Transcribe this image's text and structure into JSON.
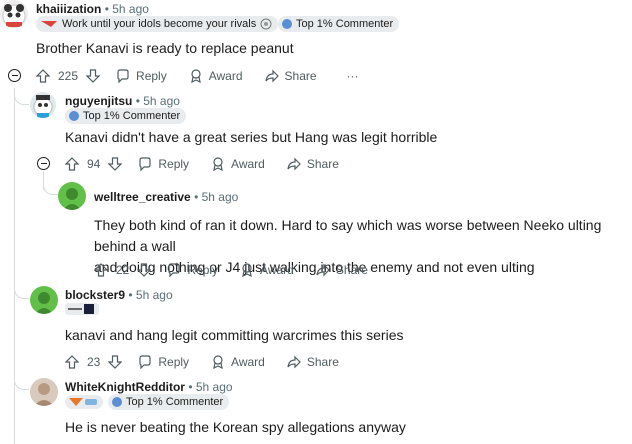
{
  "comments": [
    {
      "username": "khaiiization",
      "time": "5h ago",
      "flair_text": "Work until your idols become your rivals",
      "flair2": "Top 1% Commenter",
      "body": "Brother Kanavi is ready to replace peanut",
      "score": "225"
    },
    {
      "username": "nguyenjitsu",
      "time": "5h ago",
      "flair": "Top 1% Commenter",
      "body": "Kanavi didn't have a great series but Hang was legit horrible",
      "score": "94"
    },
    {
      "username": "welltree_creative",
      "time": "5h ago",
      "body_line1": "They both kind of ran it down. Hard to say which was worse between Neeko ulting behind a wall",
      "body_line2": "and doing nothing or J4 just walking into the enemy and not even ulting",
      "score": "22"
    },
    {
      "username": "blockster9",
      "time": "5h ago",
      "body": "kanavi and hang legit committing warcrimes this series",
      "score": "23"
    },
    {
      "username": "WhiteKnightRedditor",
      "time": "5h ago",
      "flair": "Top 1% Commenter",
      "body": "He is never beating the Korean spy allegations anyway"
    }
  ],
  "actions": {
    "reply": "Reply",
    "award": "Award",
    "share": "Share",
    "more": "···"
  },
  "colors": {
    "link": "#1c1c1c",
    "meta": "#576f76",
    "thread": "#d7dbdd",
    "flair_bg": "#e9ecee"
  }
}
